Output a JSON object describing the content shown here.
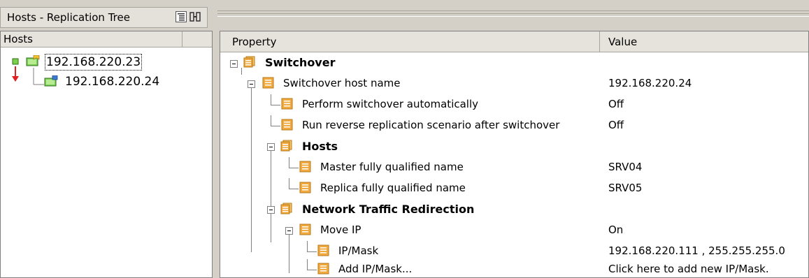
{
  "left_panel": {
    "title": "Hosts - Replication Tree",
    "toolbar_icons": [
      "tree-view-icon",
      "split-view-icon"
    ],
    "column_header": "Hosts",
    "hosts": [
      {
        "ip": "192.168.220.23",
        "role": "master",
        "selected": true
      },
      {
        "ip": "192.168.220.24",
        "role": "replica",
        "selected": false
      }
    ]
  },
  "right_panel": {
    "columns": {
      "property": "Property",
      "value": "Value"
    },
    "rows": [
      {
        "label": "Switchover",
        "value": "",
        "bold": true,
        "icon": "group-icon"
      },
      {
        "label": "Switchover host name",
        "value": "192.168.220.24",
        "bold": false,
        "icon": "property-icon"
      },
      {
        "label": "Perform switchover automatically",
        "value": "Off",
        "bold": false,
        "icon": "property-icon"
      },
      {
        "label": "Run reverse replication scenario after switchover",
        "value": "Off",
        "bold": false,
        "icon": "property-icon"
      },
      {
        "label": "Hosts",
        "value": "",
        "bold": true,
        "icon": "group-icon"
      },
      {
        "label": "Master fully qualified name",
        "value": "SRV04",
        "bold": false,
        "icon": "property-icon"
      },
      {
        "label": "Replica fully qualified name",
        "value": "SRV05",
        "bold": false,
        "icon": "property-icon"
      },
      {
        "label": "Network Traffic Redirection",
        "value": "",
        "bold": true,
        "icon": "group-icon"
      },
      {
        "label": "Move IP",
        "value": "On",
        "bold": false,
        "icon": "property-icon"
      },
      {
        "label": "IP/Mask",
        "value": "192.168.220.111 , 255.255.255.0",
        "bold": false,
        "icon": "property-icon"
      },
      {
        "label": "Add IP/Mask...",
        "value": "Click here to add new IP/Mask.",
        "bold": false,
        "icon": "property-icon"
      }
    ]
  },
  "colors": {
    "window_bg": "#d4d0c8",
    "header_bg": "#e6e3dc",
    "icon_orange": "#f0a030",
    "host_green": "#3a8a2a",
    "arrow_red": "#e02020"
  }
}
